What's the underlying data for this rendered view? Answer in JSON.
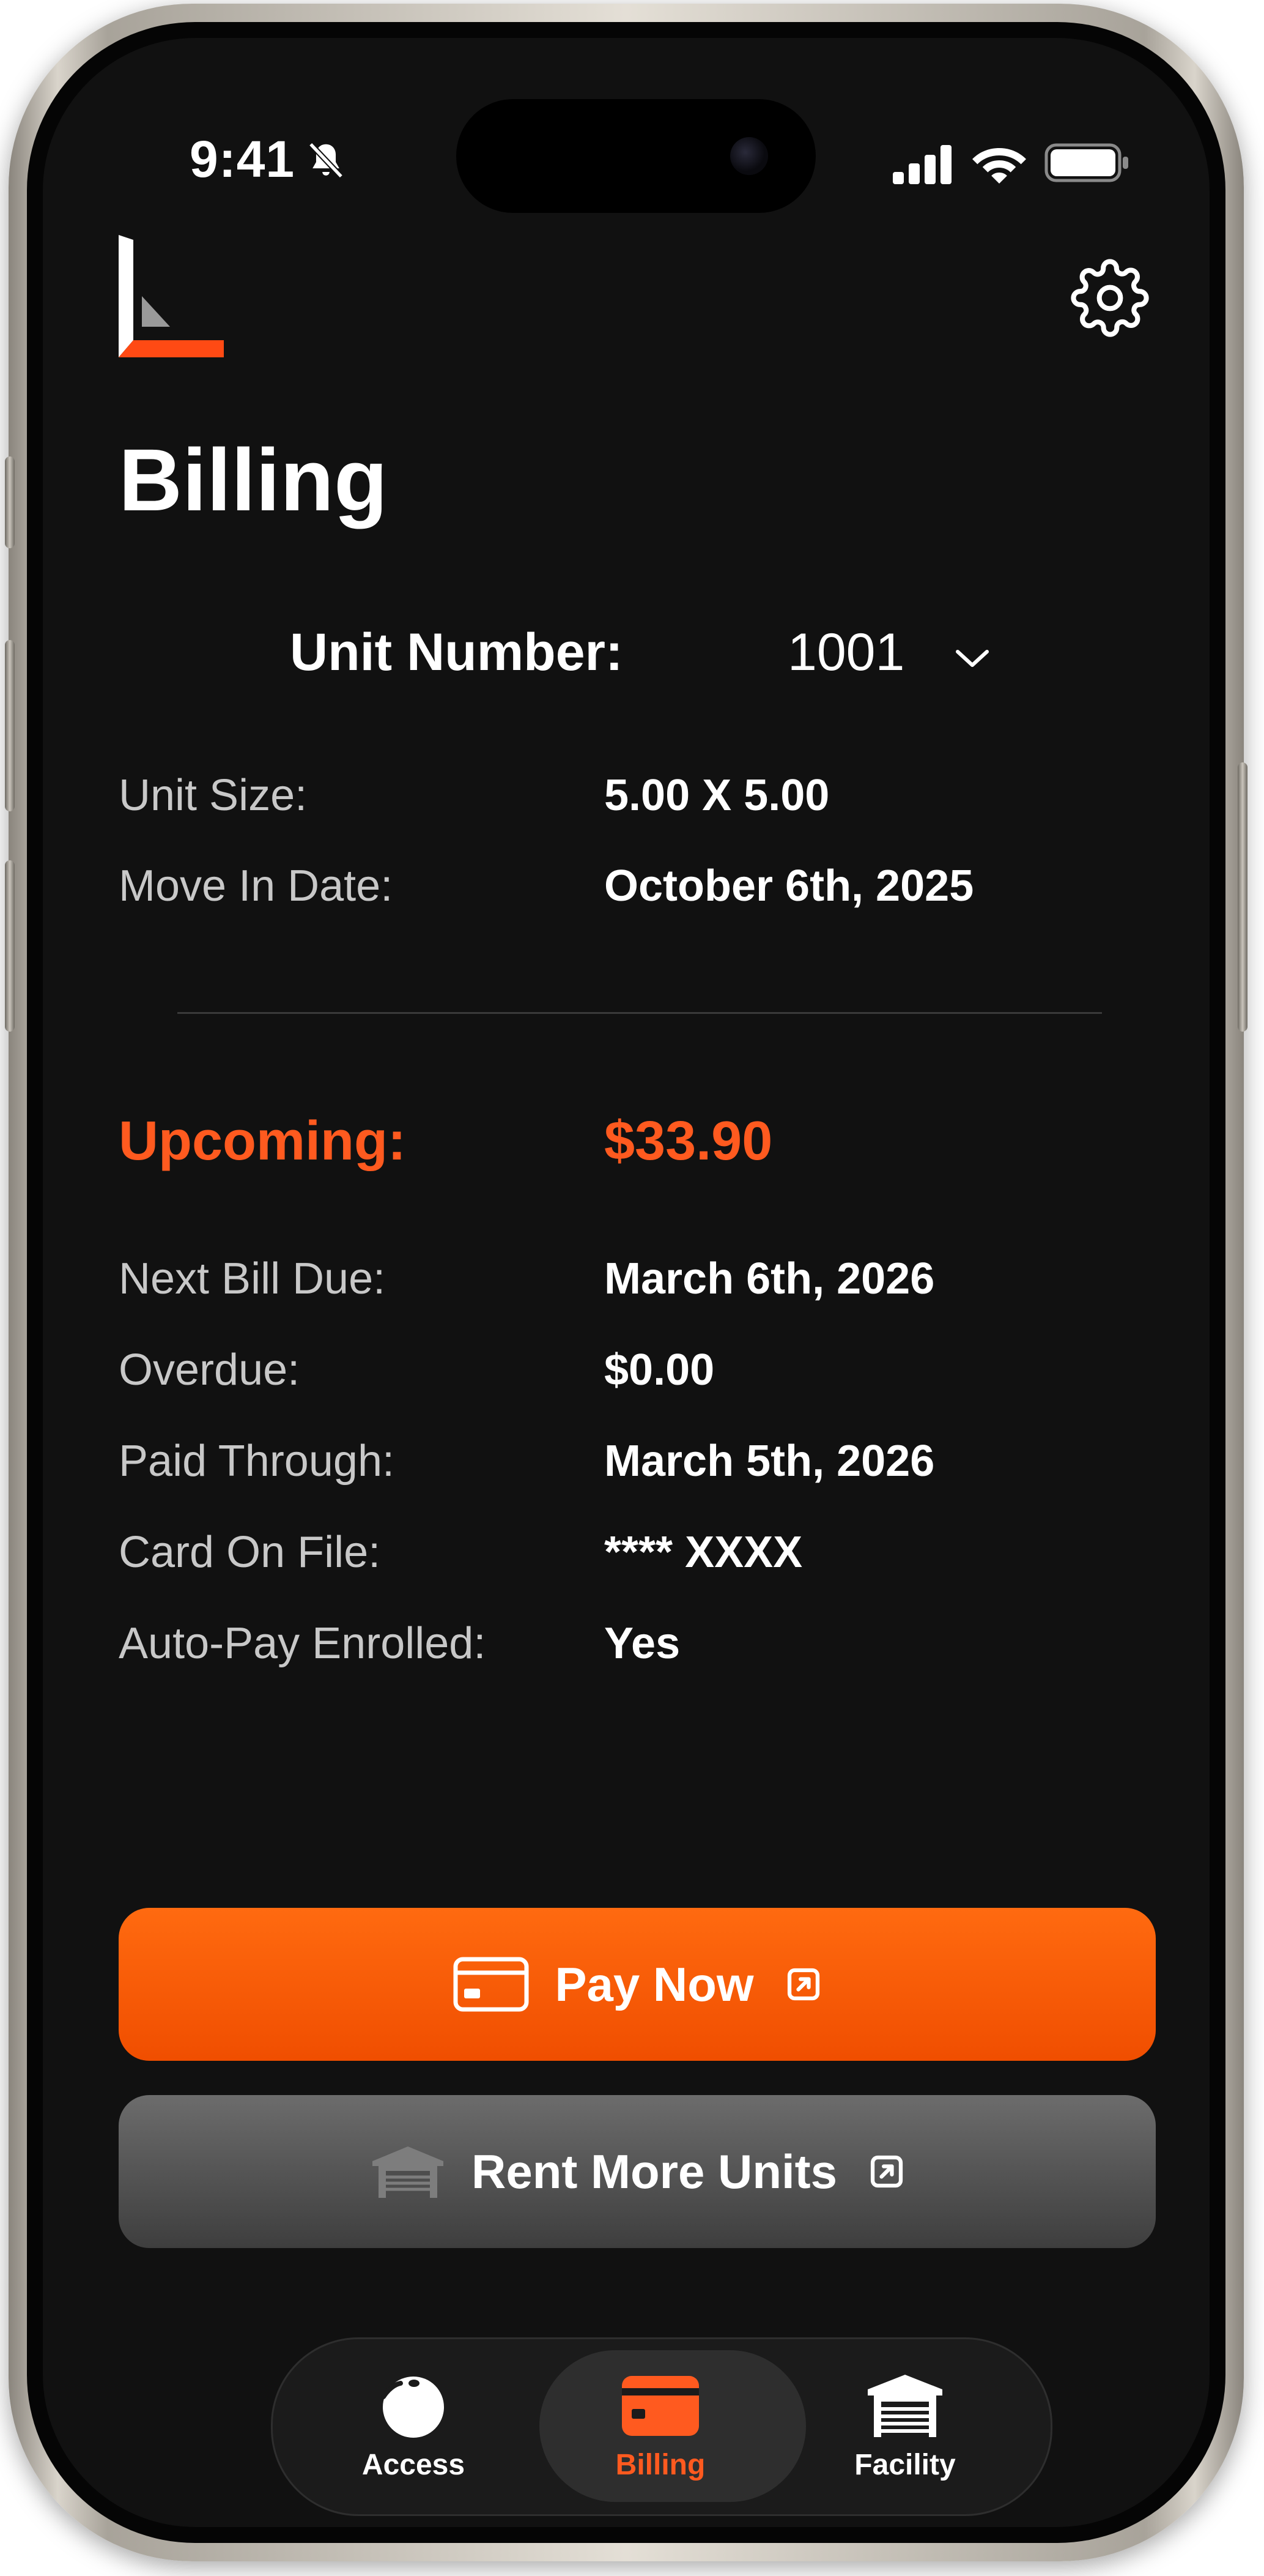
{
  "status_bar": {
    "time": "9:41"
  },
  "header": {
    "title": "Billing"
  },
  "unit_selector": {
    "label": "Unit Number:",
    "value": "1001"
  },
  "unit_details": [
    {
      "label": "Unit Size:",
      "value": "5.00 X 5.00"
    },
    {
      "label": "Move In Date:",
      "value": "October 6th, 2025"
    }
  ],
  "upcoming": {
    "label": "Upcoming:",
    "amount": "$33.90"
  },
  "billing_details": [
    {
      "label": "Next Bill Due:",
      "value": "March 6th, 2026"
    },
    {
      "label": "Overdue:",
      "value": "$0.00"
    },
    {
      "label": "Paid Through:",
      "value": "March 5th, 2026"
    },
    {
      "label": "Card On File:",
      "value": "**** XXXX"
    },
    {
      "label": "Auto-Pay Enrolled:",
      "value": "Yes"
    }
  ],
  "actions": {
    "pay_now": "Pay Now",
    "rent_more": "Rent More Units"
  },
  "tabs": [
    {
      "label": "Access",
      "icon": "access-icon"
    },
    {
      "label": "Billing",
      "icon": "credit-card-icon",
      "active": true
    },
    {
      "label": "Facility",
      "icon": "storage-unit-icon"
    }
  ],
  "colors": {
    "accent": "#ff5a1f",
    "background": "#111111"
  }
}
